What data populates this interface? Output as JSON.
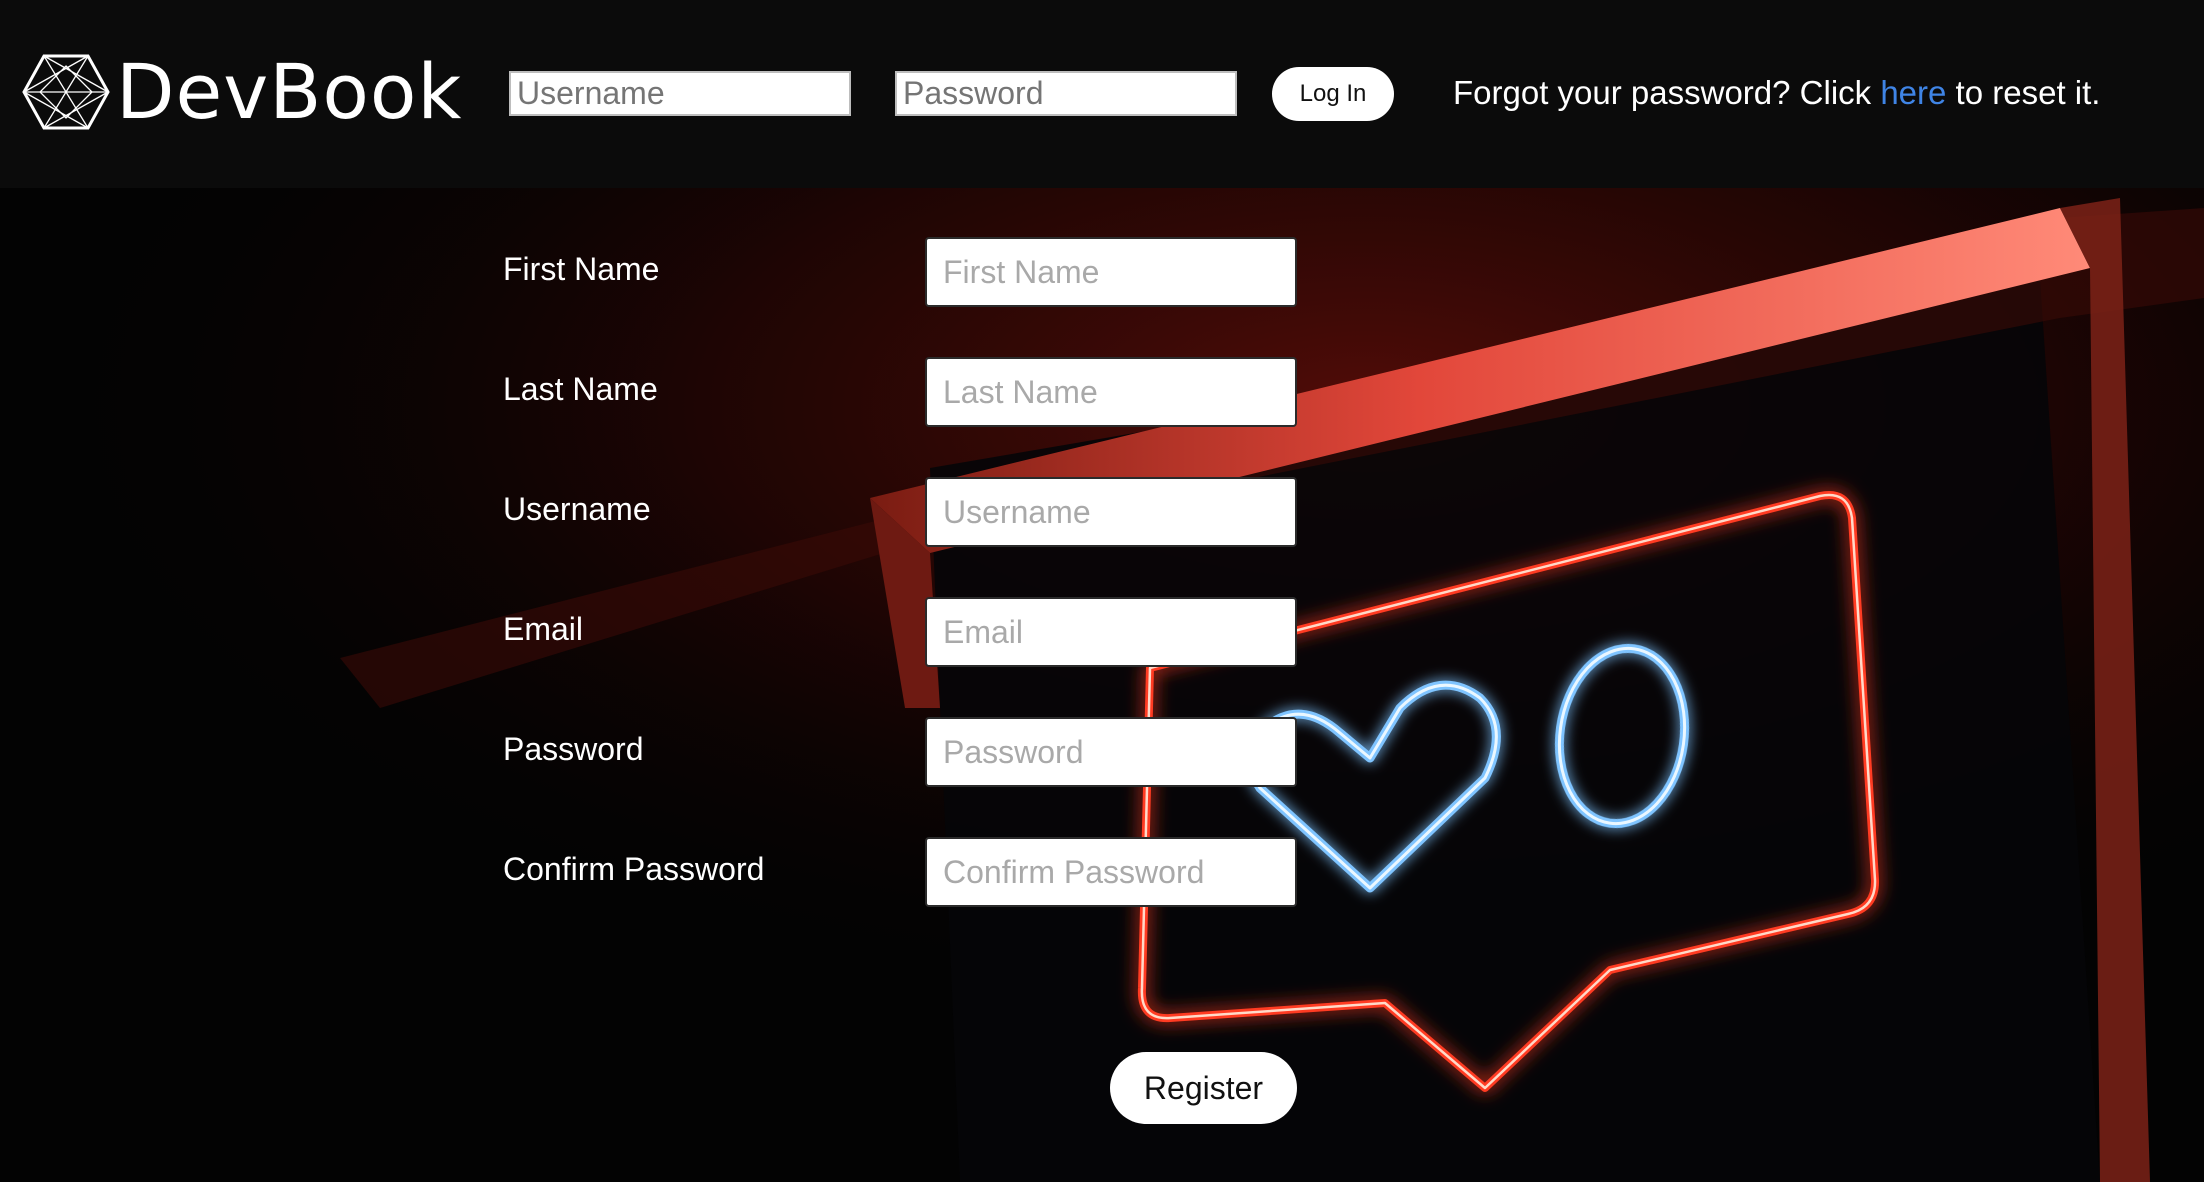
{
  "brand": {
    "name": "DevBook",
    "logo_icon": "hexagon-network-icon"
  },
  "header": {
    "username_placeholder": "Username",
    "password_placeholder": "Password",
    "login_label": "Log In",
    "forgot_prefix": "Forgot your password? Click ",
    "forgot_link": "here",
    "forgot_suffix": " to reset it.",
    "link_color": "#3f84e5"
  },
  "registration": {
    "fields": [
      {
        "label": "First Name",
        "placeholder": "First Name"
      },
      {
        "label": "Last Name",
        "placeholder": "Last Name"
      },
      {
        "label": "Username",
        "placeholder": "Username"
      },
      {
        "label": "Email",
        "placeholder": "Email"
      },
      {
        "label": "Password",
        "placeholder": "Password"
      },
      {
        "label": "Confirm Password",
        "placeholder": "Confirm Password"
      }
    ],
    "register_label": "Register"
  },
  "background": {
    "description_icon": "neon-like-notification-sign",
    "neon_red": "#ff2a1a",
    "neon_blue": "#bfe6ff",
    "like_count": "0"
  }
}
